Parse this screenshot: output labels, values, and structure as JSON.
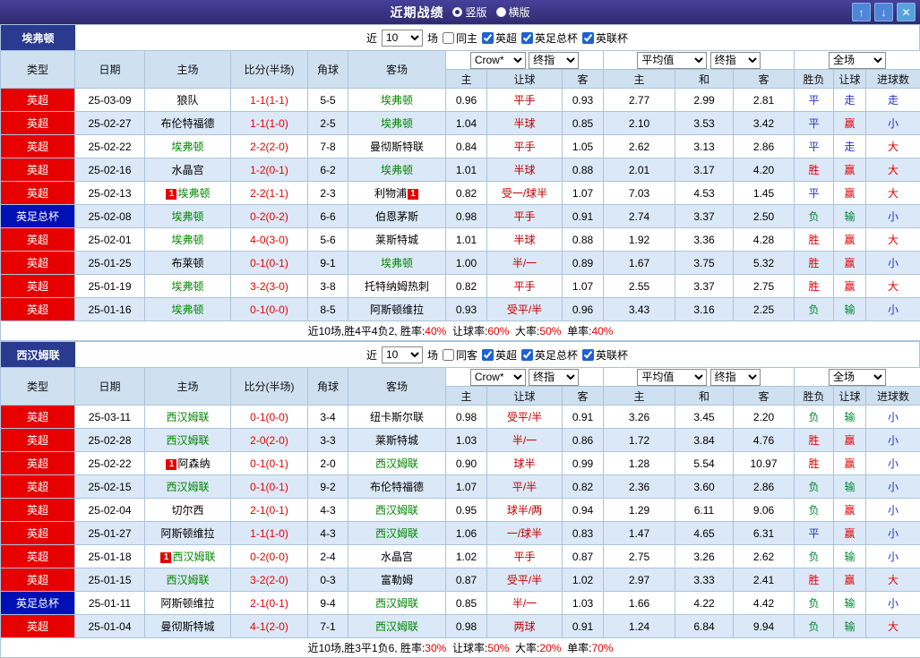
{
  "topbar": {
    "title": "近期战绩",
    "view_options": [
      {
        "label": "竖版",
        "selected": true
      },
      {
        "label": "横版",
        "selected": false
      }
    ],
    "buttons": {
      "up": "↑",
      "down": "↓",
      "close": "✕"
    }
  },
  "colors": {
    "league": {
      "英超": "#e60000",
      "英足总杯": "#0010b4"
    },
    "result": {
      "胜": "#e60000",
      "平": "#2233cc",
      "负": "#008833",
      "赢": "#e60000",
      "走": "#2233cc",
      "输": "#008833",
      "大": "#e60000",
      "小": "#2233cc"
    },
    "focal_team": "#008800",
    "score": "#e60000",
    "handicap": "#c00000"
  },
  "table_header": {
    "cols": [
      "类型",
      "日期",
      "主场",
      "比分(半场)",
      "角球",
      "客场"
    ],
    "odds_group": {
      "select1": "Crow*",
      "select2": "终指",
      "sub": [
        "主",
        "让球",
        "客"
      ]
    },
    "avg_group": {
      "select1": "平均值",
      "select2": "终指",
      "sub": [
        "主",
        "和",
        "客"
      ]
    },
    "result_group": {
      "select": "全场",
      "sub": [
        "胜负",
        "让球",
        "进球数"
      ]
    }
  },
  "sections": [
    {
      "team": "埃弗顿",
      "filter": {
        "prefix": "近",
        "count": "10",
        "suffix": "场",
        "same_label": "同主",
        "same_checked": false,
        "leagues": [
          {
            "label": "英超",
            "checked": true
          },
          {
            "label": "英足总杯",
            "checked": true
          },
          {
            "label": "英联杯",
            "checked": true
          }
        ]
      },
      "rows": [
        {
          "league": "英超",
          "date": "25-03-09",
          "home": {
            "name": "狼队"
          },
          "score": "1-1(1-1)",
          "corner": "5-5",
          "away": {
            "name": "埃弗顿",
            "focal": true
          },
          "odds": [
            "0.96",
            "平手",
            "0.93"
          ],
          "avg": [
            "2.77",
            "2.99",
            "2.81"
          ],
          "results": [
            "平",
            "走",
            "走"
          ]
        },
        {
          "league": "英超",
          "date": "25-02-27",
          "home": {
            "name": "布伦特福德"
          },
          "score": "1-1(1-0)",
          "corner": "2-5",
          "away": {
            "name": "埃弗顿",
            "focal": true
          },
          "odds": [
            "1.04",
            "半球",
            "0.85"
          ],
          "avg": [
            "2.10",
            "3.53",
            "3.42"
          ],
          "results": [
            "平",
            "赢",
            "小"
          ]
        },
        {
          "league": "英超",
          "date": "25-02-22",
          "home": {
            "name": "埃弗顿",
            "focal": true
          },
          "score": "2-2(2-0)",
          "corner": "7-8",
          "away": {
            "name": "曼彻斯特联"
          },
          "odds": [
            "0.84",
            "平手",
            "1.05"
          ],
          "avg": [
            "2.62",
            "3.13",
            "2.86"
          ],
          "results": [
            "平",
            "走",
            "大"
          ]
        },
        {
          "league": "英超",
          "date": "25-02-16",
          "home": {
            "name": "水晶宫"
          },
          "score": "1-2(0-1)",
          "corner": "6-2",
          "away": {
            "name": "埃弗顿",
            "focal": true
          },
          "odds": [
            "1.01",
            "半球",
            "0.88"
          ],
          "avg": [
            "2.01",
            "3.17",
            "4.20"
          ],
          "results": [
            "胜",
            "赢",
            "大"
          ]
        },
        {
          "league": "英超",
          "date": "25-02-13",
          "home": {
            "name": "埃弗顿",
            "focal": true,
            "red": "before"
          },
          "score": "2-2(1-1)",
          "corner": "2-3",
          "away": {
            "name": "利物浦",
            "red": "after"
          },
          "odds": [
            "0.82",
            "受一/球半",
            "1.07"
          ],
          "avg": [
            "7.03",
            "4.53",
            "1.45"
          ],
          "results": [
            "平",
            "赢",
            "大"
          ]
        },
        {
          "league": "英足总杯",
          "date": "25-02-08",
          "home": {
            "name": "埃弗顿",
            "focal": true
          },
          "score": "0-2(0-2)",
          "corner": "6-6",
          "away": {
            "name": "伯恩茅斯"
          },
          "odds": [
            "0.98",
            "平手",
            "0.91"
          ],
          "avg": [
            "2.74",
            "3.37",
            "2.50"
          ],
          "results": [
            "负",
            "输",
            "小"
          ]
        },
        {
          "league": "英超",
          "date": "25-02-01",
          "home": {
            "name": "埃弗顿",
            "focal": true
          },
          "score": "4-0(3-0)",
          "corner": "5-6",
          "away": {
            "name": "莱斯特城"
          },
          "odds": [
            "1.01",
            "半球",
            "0.88"
          ],
          "avg": [
            "1.92",
            "3.36",
            "4.28"
          ],
          "results": [
            "胜",
            "赢",
            "大"
          ]
        },
        {
          "league": "英超",
          "date": "25-01-25",
          "home": {
            "name": "布莱顿"
          },
          "score": "0-1(0-1)",
          "corner": "9-1",
          "away": {
            "name": "埃弗顿",
            "focal": true
          },
          "odds": [
            "1.00",
            "半/一",
            "0.89"
          ],
          "avg": [
            "1.67",
            "3.75",
            "5.32"
          ],
          "results": [
            "胜",
            "赢",
            "小"
          ]
        },
        {
          "league": "英超",
          "date": "25-01-19",
          "home": {
            "name": "埃弗顿",
            "focal": true
          },
          "score": "3-2(3-0)",
          "corner": "3-8",
          "away": {
            "name": "托特纳姆热刺"
          },
          "odds": [
            "0.82",
            "平手",
            "1.07"
          ],
          "avg": [
            "2.55",
            "3.37",
            "2.75"
          ],
          "results": [
            "胜",
            "赢",
            "大"
          ]
        },
        {
          "league": "英超",
          "date": "25-01-16",
          "home": {
            "name": "埃弗顿",
            "focal": true
          },
          "score": "0-1(0-0)",
          "corner": "8-5",
          "away": {
            "name": "阿斯顿维拉"
          },
          "odds": [
            "0.93",
            "受平/半",
            "0.96"
          ],
          "avg": [
            "3.43",
            "3.16",
            "2.25"
          ],
          "results": [
            "负",
            "输",
            "小"
          ]
        }
      ],
      "summary": {
        "prefix": "近10场,胜4平4负2, ",
        "stats": [
          {
            "label": "胜率:",
            "value": "40%"
          },
          {
            "label": "让球率:",
            "value": "60%"
          },
          {
            "label": "大率:",
            "value": "50%"
          },
          {
            "label": "单率:",
            "value": "40%"
          }
        ]
      }
    },
    {
      "team": "西汉姆联",
      "filter": {
        "prefix": "近",
        "count": "10",
        "suffix": "场",
        "same_label": "同客",
        "same_checked": false,
        "leagues": [
          {
            "label": "英超",
            "checked": true
          },
          {
            "label": "英足总杯",
            "checked": true
          },
          {
            "label": "英联杯",
            "checked": true
          }
        ]
      },
      "rows": [
        {
          "league": "英超",
          "date": "25-03-11",
          "home": {
            "name": "西汉姆联",
            "focal": true
          },
          "score": "0-1(0-0)",
          "corner": "3-4",
          "away": {
            "name": "纽卡斯尔联"
          },
          "odds": [
            "0.98",
            "受平/半",
            "0.91"
          ],
          "avg": [
            "3.26",
            "3.45",
            "2.20"
          ],
          "results": [
            "负",
            "输",
            "小"
          ]
        },
        {
          "league": "英超",
          "date": "25-02-28",
          "home": {
            "name": "西汉姆联",
            "focal": true
          },
          "score": "2-0(2-0)",
          "corner": "3-3",
          "away": {
            "name": "莱斯特城"
          },
          "odds": [
            "1.03",
            "半/一",
            "0.86"
          ],
          "avg": [
            "1.72",
            "3.84",
            "4.76"
          ],
          "results": [
            "胜",
            "赢",
            "小"
          ]
        },
        {
          "league": "英超",
          "date": "25-02-22",
          "home": {
            "name": "阿森纳",
            "red": "before"
          },
          "score": "0-1(0-1)",
          "corner": "2-0",
          "away": {
            "name": "西汉姆联",
            "focal": true
          },
          "odds": [
            "0.90",
            "球半",
            "0.99"
          ],
          "avg": [
            "1.28",
            "5.54",
            "10.97"
          ],
          "results": [
            "胜",
            "赢",
            "小"
          ]
        },
        {
          "league": "英超",
          "date": "25-02-15",
          "home": {
            "name": "西汉姆联",
            "focal": true
          },
          "score": "0-1(0-1)",
          "corner": "9-2",
          "away": {
            "name": "布伦特福德"
          },
          "odds": [
            "1.07",
            "平/半",
            "0.82"
          ],
          "avg": [
            "2.36",
            "3.60",
            "2.86"
          ],
          "results": [
            "负",
            "输",
            "小"
          ]
        },
        {
          "league": "英超",
          "date": "25-02-04",
          "home": {
            "name": "切尔西"
          },
          "score": "2-1(0-1)",
          "corner": "4-3",
          "away": {
            "name": "西汉姆联",
            "focal": true
          },
          "odds": [
            "0.95",
            "球半/两",
            "0.94"
          ],
          "avg": [
            "1.29",
            "6.11",
            "9.06"
          ],
          "results": [
            "负",
            "赢",
            "小"
          ]
        },
        {
          "league": "英超",
          "date": "25-01-27",
          "home": {
            "name": "阿斯顿维拉"
          },
          "score": "1-1(1-0)",
          "corner": "4-3",
          "away": {
            "name": "西汉姆联",
            "focal": true
          },
          "odds": [
            "1.06",
            "一/球半",
            "0.83"
          ],
          "avg": [
            "1.47",
            "4.65",
            "6.31"
          ],
          "results": [
            "平",
            "赢",
            "小"
          ]
        },
        {
          "league": "英超",
          "date": "25-01-18",
          "home": {
            "name": "西汉姆联",
            "focal": true,
            "red": "before"
          },
          "score": "0-2(0-0)",
          "corner": "2-4",
          "away": {
            "name": "水晶宫"
          },
          "odds": [
            "1.02",
            "平手",
            "0.87"
          ],
          "avg": [
            "2.75",
            "3.26",
            "2.62"
          ],
          "results": [
            "负",
            "输",
            "小"
          ]
        },
        {
          "league": "英超",
          "date": "25-01-15",
          "home": {
            "name": "西汉姆联",
            "focal": true
          },
          "score": "3-2(2-0)",
          "corner": "0-3",
          "away": {
            "name": "富勒姆"
          },
          "odds": [
            "0.87",
            "受平/半",
            "1.02"
          ],
          "avg": [
            "2.97",
            "3.33",
            "2.41"
          ],
          "results": [
            "胜",
            "赢",
            "大"
          ]
        },
        {
          "league": "英足总杯",
          "date": "25-01-11",
          "home": {
            "name": "阿斯顿维拉"
          },
          "score": "2-1(0-1)",
          "corner": "9-4",
          "away": {
            "name": "西汉姆联",
            "focal": true
          },
          "odds": [
            "0.85",
            "半/一",
            "1.03"
          ],
          "avg": [
            "1.66",
            "4.22",
            "4.42"
          ],
          "results": [
            "负",
            "输",
            "小"
          ]
        },
        {
          "league": "英超",
          "date": "25-01-04",
          "home": {
            "name": "曼彻斯特城"
          },
          "score": "4-1(2-0)",
          "corner": "7-1",
          "away": {
            "name": "西汉姆联",
            "focal": true
          },
          "odds": [
            "0.98",
            "两球",
            "0.91"
          ],
          "avg": [
            "1.24",
            "6.84",
            "9.94"
          ],
          "results": [
            "负",
            "输",
            "大"
          ]
        }
      ],
      "summary": {
        "prefix": "近10场,胜3平1负6, ",
        "stats": [
          {
            "label": "胜率:",
            "value": "30%"
          },
          {
            "label": "让球率:",
            "value": "50%"
          },
          {
            "label": "大率:",
            "value": "20%"
          },
          {
            "label": "单率:",
            "value": "70%"
          }
        ]
      }
    }
  ]
}
